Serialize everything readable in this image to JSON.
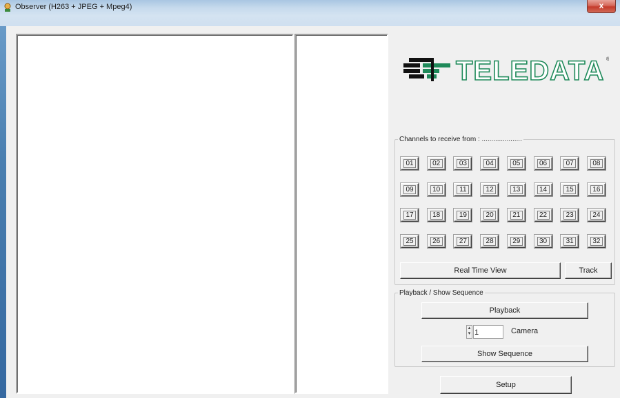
{
  "window": {
    "title": "Observer (H263 + JPEG + Mpeg4)",
    "close_label": "x"
  },
  "logo": {
    "text": "TELEDATA",
    "mark": "®"
  },
  "channels": {
    "legend": "Channels to receive from : .....................",
    "buttons": [
      "01",
      "02",
      "03",
      "04",
      "05",
      "06",
      "07",
      "08",
      "09",
      "10",
      "11",
      "12",
      "13",
      "14",
      "15",
      "16",
      "17",
      "18",
      "19",
      "20",
      "21",
      "22",
      "23",
      "24",
      "25",
      "26",
      "27",
      "28",
      "29",
      "30",
      "31",
      "32"
    ],
    "real_time_label": "Real Time View",
    "track_label": "Track"
  },
  "playback": {
    "legend": "Playback / Show Sequence",
    "playback_label": "Playback",
    "camera_value": "1",
    "camera_label": "Camera",
    "show_sequence_label": "Show Sequence"
  },
  "setup_label": "Setup",
  "colors": {
    "logo_green": "#1f8a5a",
    "logo_dark": "#111111",
    "frame_blue": "#4a7fb0"
  }
}
